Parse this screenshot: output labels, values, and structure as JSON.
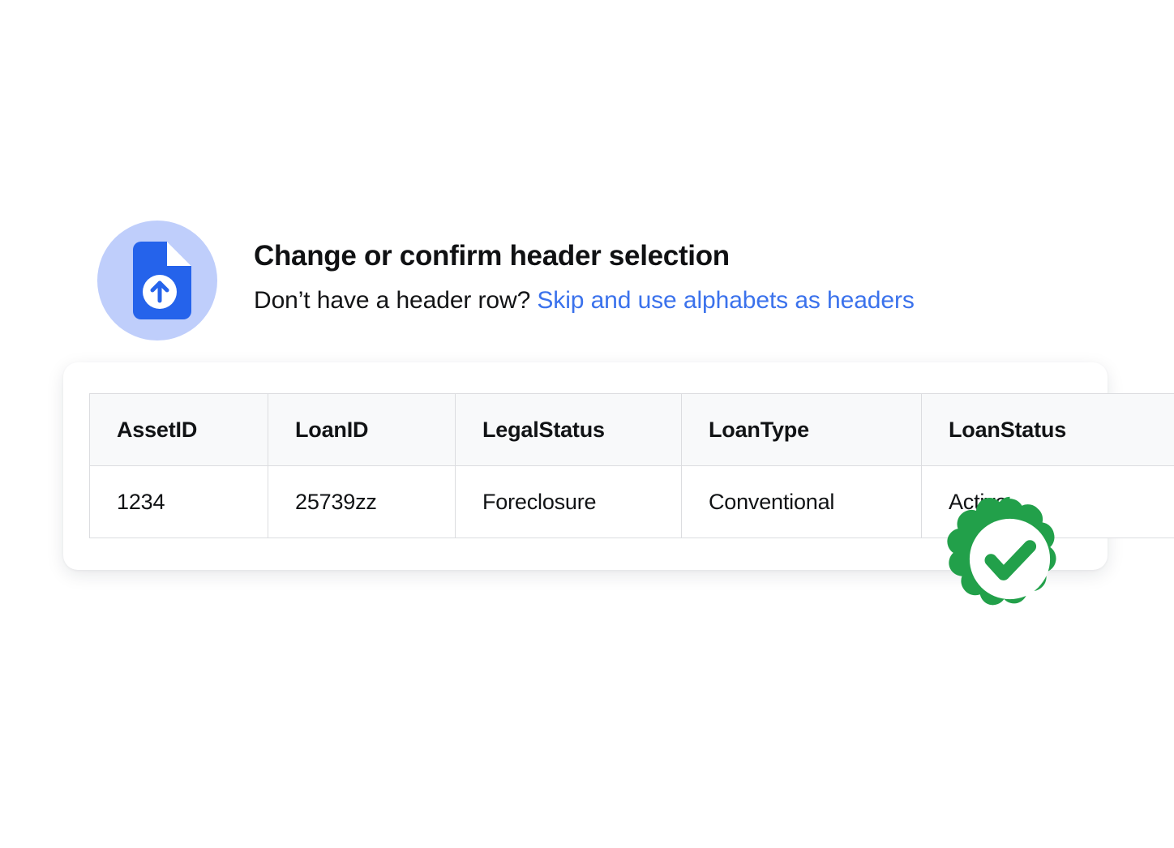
{
  "header": {
    "icon": "document-upload-icon",
    "title": "Change or confirm header selection",
    "subtitle_prefix": "Don’t have a header row? ",
    "subtitle_link": "Skip and use alphabets as headers"
  },
  "table": {
    "columns": [
      "AssetID",
      "LoanID",
      "LegalStatus",
      "LoanType",
      "LoanStatus"
    ],
    "rows": [
      [
        "1234",
        "25739zz",
        "Foreclosure",
        "Conventional",
        "Active"
      ]
    ]
  },
  "badge": {
    "icon": "verified-check-badge-icon"
  },
  "colors": {
    "link": "#3b72ec",
    "icon_document": "#2563eb",
    "icon_circle_bg": "#bfcefb",
    "badge_green": "#22a04a",
    "header_row_bg": "#f8f9fa",
    "border": "#dcdde0",
    "text": "#111315"
  }
}
